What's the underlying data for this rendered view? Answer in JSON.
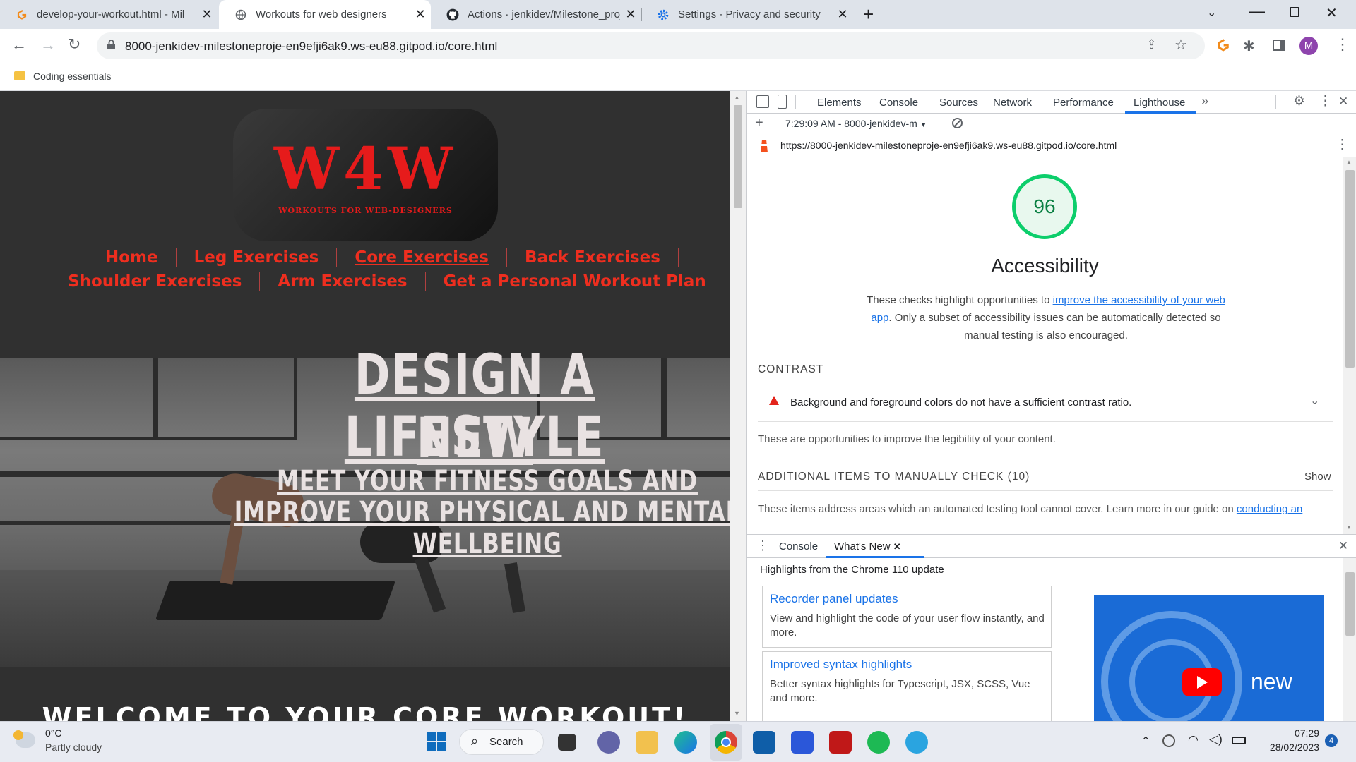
{
  "browser": {
    "tabs": [
      {
        "title": "develop-your-workout.html - Mil",
        "icon": "gitpod-icon",
        "active": false
      },
      {
        "title": "Workouts for web designers",
        "icon": "globe-icon",
        "active": true
      },
      {
        "title": "Actions · jenkidev/Milestone_proj",
        "icon": "github-icon",
        "active": false
      },
      {
        "title": "Settings - Privacy and security",
        "icon": "gear-icon",
        "active": false
      }
    ],
    "new_tab": "+",
    "url": "8000-jenkidev-milestoneproje-en9efji6ak9.ws-eu88.gitpod.io/core.html",
    "profile_initial": "M",
    "bookmark": "Coding essentials"
  },
  "site": {
    "logo_big": "W4W",
    "logo_small": "WORKOUTS FOR WEB-DESIGNERS",
    "nav_row1": [
      "Home",
      "Leg Exercises",
      "Core Exercises",
      "Back Exercises"
    ],
    "nav_row2": [
      "Shoulder Exercises",
      "Arm Exercises",
      "Get a Personal Workout Plan"
    ],
    "hero_title_1": "DESIGN A NEW",
    "hero_title_2": "LIFESTYLE",
    "hero_sub_1": "MEET YOUR FITNESS GOALS AND",
    "hero_sub_2": "IMPROVE YOUR PHYSICAL AND MENTAL",
    "hero_sub_3": "WELLBEING",
    "welcome": "WELCOME TO YOUR CORE WORKOUT!"
  },
  "devtools": {
    "tabs": [
      "Elements",
      "Console",
      "Sources",
      "Network",
      "Performance",
      "Lighthouse"
    ],
    "active_tab": "Lighthouse",
    "more": "»",
    "report_select": "7:29:09 AM - 8000-jenkidev-m",
    "report_url": "https://8000-jenkidev-milestoneproje-en9efji6ak9.ws-eu88.gitpod.io/core.html",
    "score": "96",
    "category": "Accessibility",
    "desc_1": "These checks highlight opportunities to ",
    "desc_link": "improve the accessibility of your web app",
    "desc_2": ". Only a subset of accessibility issues can be automatically detected so manual testing is also encouraged.",
    "contrast_heading": "CONTRAST",
    "contrast_audit": "Background and foreground colors do not have a sufficient contrast ratio.",
    "contrast_note": "These are opportunities to improve the legibility of your content.",
    "manual_heading": "ADDITIONAL ITEMS TO MANUALLY CHECK (10)",
    "show": "Show",
    "manual_note": "These items address areas which an automated testing tool cannot cover. Learn more in our guide on ",
    "manual_link": "conducting an",
    "drawer_tabs": [
      "Console",
      "What's New"
    ],
    "drawer_highlights": "Highlights from the Chrome 110 update",
    "cards": [
      {
        "title": "Recorder panel updates",
        "desc": "View and highlight the code of your user flow instantly, and more."
      },
      {
        "title": "Improved syntax highlights",
        "desc": "Better syntax highlights for Typescript, JSX, SCSS, Vue and more."
      }
    ],
    "video_text": "new"
  },
  "taskbar": {
    "temp": "0°C",
    "weather": "Partly cloudy",
    "search": "Search",
    "time": "07:29",
    "date": "28/02/2023",
    "badge": "4"
  },
  "colors": {
    "nav_red": "#ee2e1f",
    "score_green": "#0cce6b",
    "link_blue": "#1a73e8"
  }
}
